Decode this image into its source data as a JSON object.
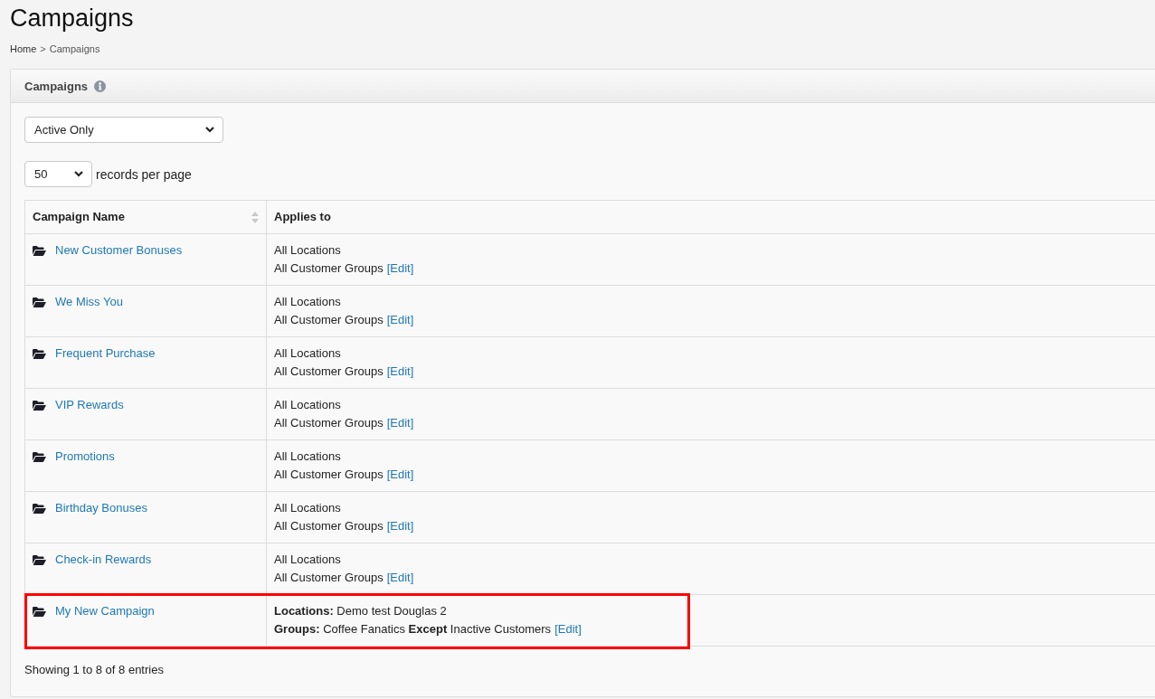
{
  "page_title": "Campaigns",
  "breadcrumb": {
    "items": [
      "Home",
      "Campaigns"
    ],
    "separator": ">"
  },
  "panel": {
    "title": "Campaigns",
    "status_filter": {
      "value": "Active Only"
    },
    "page_size": {
      "value": "50",
      "label": "records per page"
    },
    "table": {
      "columns": [
        {
          "label": "Campaign Name",
          "sortable": true
        },
        {
          "label": "Applies to",
          "sortable": false
        }
      ],
      "rows": [
        {
          "name": "New Customer Bonuses",
          "locations": "All Locations",
          "groups": "All Customer Groups",
          "edit": "[Edit]",
          "highlighted": false
        },
        {
          "name": "We Miss You",
          "locations": "All Locations",
          "groups": "All Customer Groups",
          "edit": "[Edit]",
          "highlighted": false
        },
        {
          "name": "Frequent Purchase",
          "locations": "All Locations",
          "groups": "All Customer Groups",
          "edit": "[Edit]",
          "highlighted": false
        },
        {
          "name": "VIP Rewards",
          "locations": "All Locations",
          "groups": "All Customer Groups",
          "edit": "[Edit]",
          "highlighted": false
        },
        {
          "name": "Promotions",
          "locations": "All Locations",
          "groups": "All Customer Groups",
          "edit": "[Edit]",
          "highlighted": false
        },
        {
          "name": "Birthday Bonuses",
          "locations": "All Locations",
          "groups": "All Customer Groups",
          "edit": "[Edit]",
          "highlighted": false
        },
        {
          "name": "Check-in Rewards",
          "locations": "All Locations",
          "groups": "All Customer Groups",
          "edit": "[Edit]",
          "highlighted": false
        },
        {
          "name": "My New Campaign",
          "locations": "**Locations:** Demo test Douglas 2",
          "groups": "**Groups:** Coffee Fanatics **Except** Inactive Customers",
          "edit": "[Edit]",
          "highlighted": true
        }
      ]
    },
    "footer": "Showing 1 to 8 of 8 entries"
  }
}
